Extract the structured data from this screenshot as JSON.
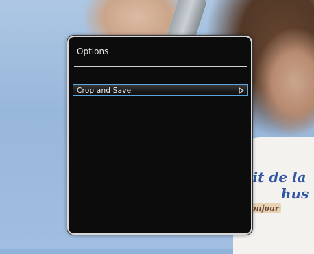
{
  "dialog": {
    "title": "Options",
    "menu_items": [
      {
        "label": "Crop and Save",
        "icon": "chevron-right-icon"
      }
    ]
  },
  "background": {
    "shirt_texts": [
      "uit de la",
      "hus",
      "Bonjour"
    ]
  },
  "colors": {
    "dialog_bg": "#0c0c0c",
    "dialog_border": "#d7d7d7",
    "highlight_border": "#5aa6e0",
    "text": "#f0f0f0"
  }
}
